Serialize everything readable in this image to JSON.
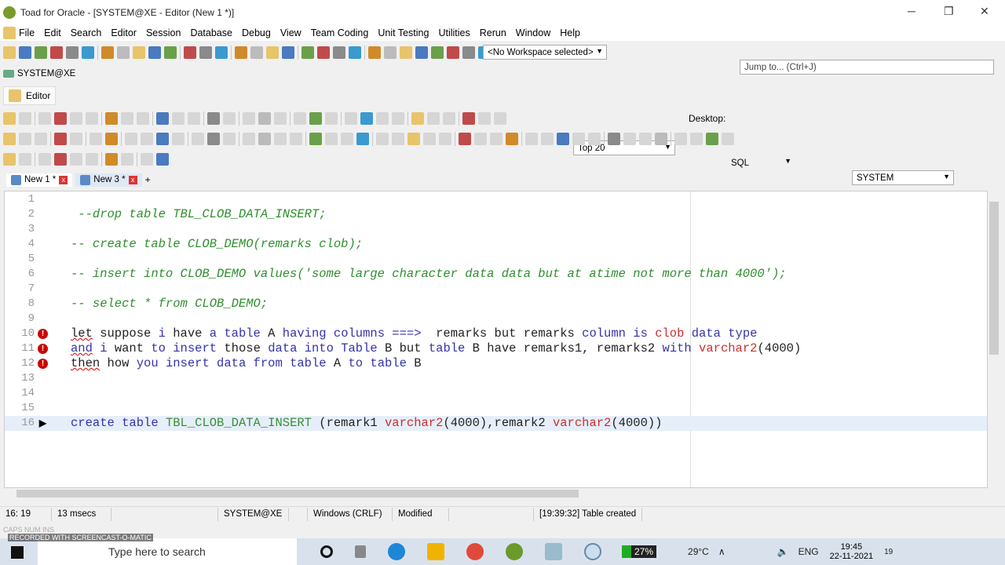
{
  "window": {
    "title": "Toad for Oracle - [SYSTEM@XE - Editor (New 1 *)]",
    "controls": [
      "─",
      "❐",
      "✕"
    ]
  },
  "menu": [
    "File",
    "Edit",
    "Search",
    "Editor",
    "Session",
    "Database",
    "Debug",
    "View",
    "Team Coding",
    "Unit Testing",
    "Utilities",
    "Rerun",
    "Window",
    "Help"
  ],
  "toolbar": {
    "workspace": "<No Workspace selected>",
    "jump_placeholder": "Jump to... (Ctrl+J)",
    "top_rows": "Top 20",
    "desktop_label": "Desktop:",
    "desktop_value": "SQL",
    "schema": "SYSTEM"
  },
  "connection": "SYSTEM@XE",
  "editor_tab": "Editor",
  "doc_tabs": [
    {
      "label": "New 1 *",
      "active": true
    },
    {
      "label": "New 3 *",
      "active": false
    }
  ],
  "add_tab": "+",
  "code_lines": [
    {
      "n": "1",
      "mark": "",
      "tokens": []
    },
    {
      "n": "2",
      "mark": "",
      "tokens": [
        {
          "t": " --drop table TBL_CLOB_DATA_INSERT;",
          "c": "cm"
        }
      ]
    },
    {
      "n": "3",
      "mark": "",
      "tokens": []
    },
    {
      "n": "4",
      "mark": "",
      "tokens": [
        {
          "t": "-- create table CLOB_DEMO(remarks clob);",
          "c": "cm"
        }
      ]
    },
    {
      "n": "5",
      "mark": "",
      "tokens": []
    },
    {
      "n": "6",
      "mark": "",
      "tokens": [
        {
          "t": "-- insert into CLOB_DEMO values('some large character data data but at atime not more than 4000');",
          "c": "cm"
        }
      ]
    },
    {
      "n": "7",
      "mark": "",
      "tokens": []
    },
    {
      "n": "8",
      "mark": "",
      "tokens": [
        {
          "t": "-- select * from CLOB_DEMO;",
          "c": "cm"
        }
      ]
    },
    {
      "n": "9",
      "mark": "",
      "tokens": []
    },
    {
      "n": "10",
      "mark": "error",
      "tokens": [
        {
          "t": "let",
          "c": "tx",
          "sq": true
        },
        {
          "t": " suppose ",
          "c": "tx"
        },
        {
          "t": "i",
          "c": "kw"
        },
        {
          "t": " have ",
          "c": "tx"
        },
        {
          "t": "a table",
          "c": "kw"
        },
        {
          "t": " A ",
          "c": "tx"
        },
        {
          "t": "having columns ===>",
          "c": "kw"
        },
        {
          "t": "  remarks but remarks ",
          "c": "tx"
        },
        {
          "t": "column is",
          "c": "kw"
        },
        {
          "t": " ",
          "c": "tx"
        },
        {
          "t": "clob",
          "c": "ty"
        },
        {
          "t": " data type",
          "c": "kw"
        }
      ]
    },
    {
      "n": "11",
      "mark": "error",
      "tokens": [
        {
          "t": "and",
          "c": "kw",
          "sq": true
        },
        {
          "t": " ",
          "c": "tx"
        },
        {
          "t": "i",
          "c": "kw"
        },
        {
          "t": " want ",
          "c": "tx"
        },
        {
          "t": "to insert",
          "c": "kw"
        },
        {
          "t": " those ",
          "c": "tx"
        },
        {
          "t": "data into Table",
          "c": "kw"
        },
        {
          "t": " B but ",
          "c": "tx"
        },
        {
          "t": "table",
          "c": "kw"
        },
        {
          "t": " B have remarks1, remarks2 ",
          "c": "tx"
        },
        {
          "t": "with",
          "c": "kw"
        },
        {
          "t": " ",
          "c": "tx"
        },
        {
          "t": "varchar2",
          "c": "ty"
        },
        {
          "t": "(4000)",
          "c": "tx"
        }
      ]
    },
    {
      "n": "12",
      "mark": "error",
      "tokens": [
        {
          "t": "then",
          "c": "tx",
          "sq": true
        },
        {
          "t": " how ",
          "c": "tx"
        },
        {
          "t": "you insert data from table",
          "c": "kw"
        },
        {
          "t": " A ",
          "c": "tx"
        },
        {
          "t": "to table",
          "c": "kw"
        },
        {
          "t": " B",
          "c": "tx"
        }
      ]
    },
    {
      "n": "13",
      "mark": "",
      "tokens": []
    },
    {
      "n": "14",
      "mark": "",
      "tokens": []
    },
    {
      "n": "15",
      "mark": "",
      "tokens": []
    },
    {
      "n": "16",
      "mark": "current",
      "tokens": [
        {
          "t": "create table",
          "c": "kw"
        },
        {
          "t": " ",
          "c": "tx"
        },
        {
          "t": "TBL_CLOB_DATA_INSERT",
          "c": "id"
        },
        {
          "t": " (remark1 ",
          "c": "tx"
        },
        {
          "t": "varchar2",
          "c": "ty"
        },
        {
          "t": "(4000),remark2 ",
          "c": "tx"
        },
        {
          "t": "varchar2",
          "c": "ty"
        },
        {
          "t": "(4000))",
          "c": "tx"
        }
      ]
    }
  ],
  "status": {
    "position": "16: 19",
    "time": "13 msecs",
    "connection": "SYSTEM@XE",
    "line_ending": "Windows (CRLF)",
    "state": "Modified",
    "message": "[19:39:32]  Table created",
    "caps": "CAPS  NUM  INS"
  },
  "taskbar": {
    "watermark": "RECORDED WITH SCREENCAST-O-MATIC",
    "search_placeholder": "Type here to search",
    "battery": "27%",
    "weather": "29°C",
    "lang": "ENG",
    "time": "19:45",
    "date": "22-11-2021",
    "notifications": "19"
  },
  "colors": {
    "comment": "#2f8f2f",
    "keyword": "#3333aa",
    "type": "#cc3030",
    "error_marker": "#cc0000",
    "current_line": "#e6eef9"
  }
}
